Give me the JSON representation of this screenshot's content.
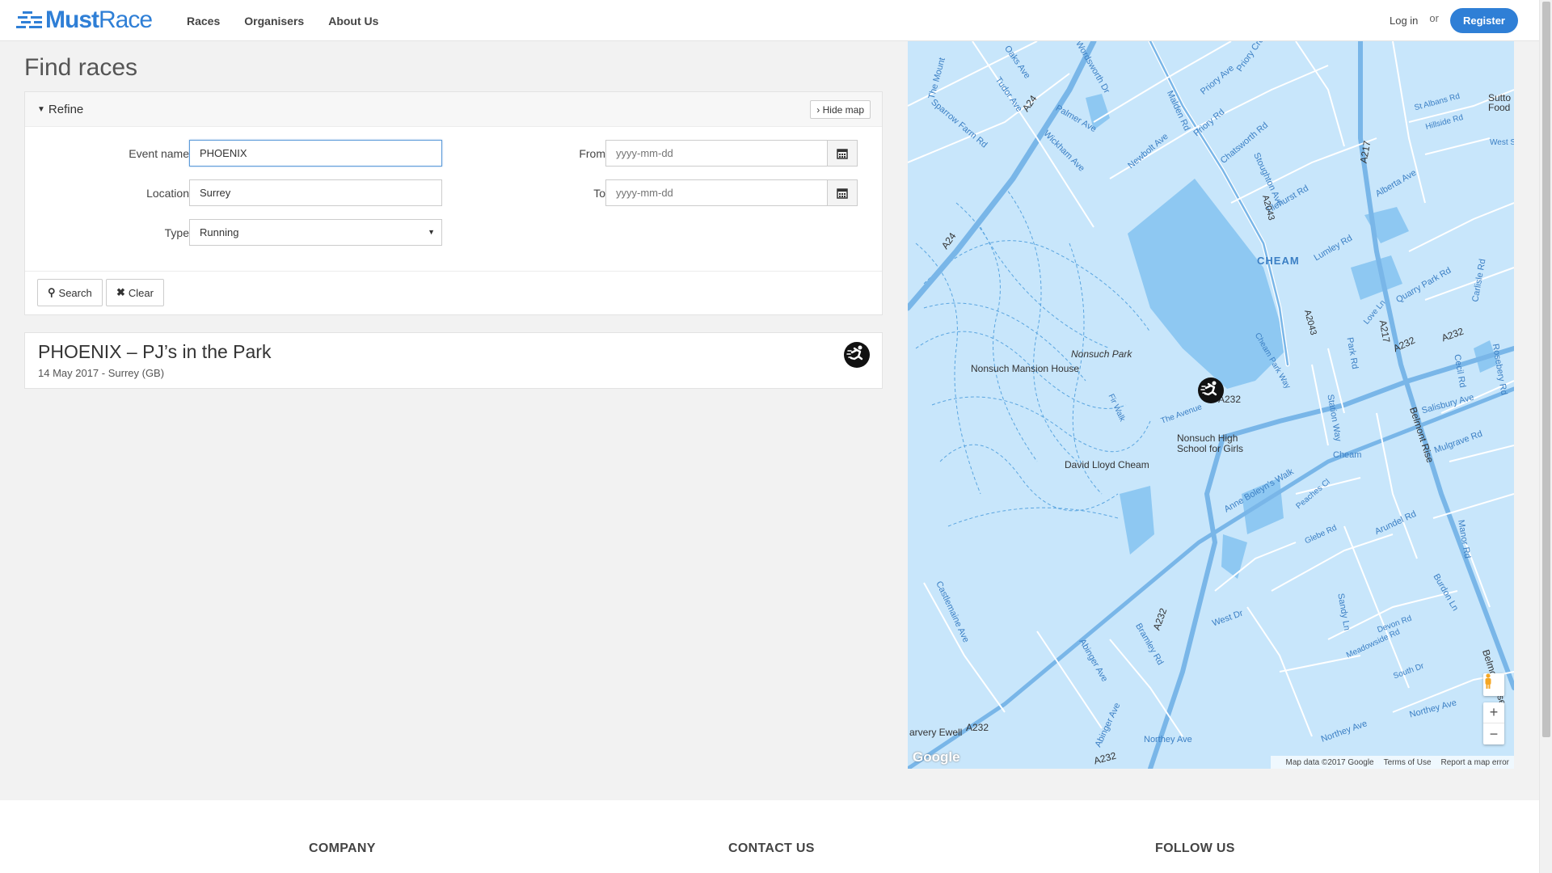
{
  "header": {
    "logo_bold": "Must",
    "logo_light": "Race",
    "nav": [
      {
        "label": "Races"
      },
      {
        "label": "Organisers"
      },
      {
        "label": "About Us"
      }
    ],
    "login_label": "Log in",
    "or_label": "or",
    "register_label": "Register",
    "accent_color": "#2f7fd6"
  },
  "main": {
    "title": "Find races",
    "refine": {
      "title": "Refine",
      "hide_map_label": "Hide map",
      "event_name_label": "Event name",
      "event_name_value": "PHOENIX",
      "location_label": "Location",
      "location_value": "Surrey",
      "type_label": "Type",
      "type_value": "Running",
      "from_label": "From",
      "from_placeholder": "yyyy-mm-dd",
      "to_label": "To",
      "to_placeholder": "yyyy-mm-dd",
      "search_label": "Search",
      "clear_label": "Clear"
    },
    "results": [
      {
        "title": "PHOENIX – PJ’s in the Park",
        "meta": "14 May 2017 - Surrey (GB)",
        "icon": "running-icon"
      }
    ]
  },
  "map": {
    "labels": {
      "cheam": "CHEAM",
      "nonsuch_park": "Nonsuch Park",
      "nonsuch_mansion": "Nonsuch Mansion House",
      "nonsuch_school": "Nonsuch High School for Girls",
      "david_lloyd": "David Lloyd Cheam",
      "cheam_station": "Cheam",
      "harvey_ewell": "arvery Ewell",
      "sutton": "Sutto Food",
      "a24": "A24",
      "a232": "A232",
      "a217": "A217",
      "belmont_rise": "Belmont Rise",
      "tudor_ave": "Tudor Ave",
      "the_mount": "The Mount",
      "sparrow_farm": "Sparrow Farm Rd",
      "palmer_ave": "Palmer Ave",
      "wickham_ave": "Wickham Ave",
      "newbolt_ave": "Newbolt Ave",
      "malden_rd": "Malden Rd",
      "priory_rd": "Priory Rd",
      "priory_ave": "Priory Ave",
      "chatsworth_rd": "Chatsworth Rd",
      "stoughton_ave": "Stoughton Ave",
      "tilehurst_rd": "Tilehurst Rd",
      "alberta_ave": "Alberta Ave",
      "lumley_rd": "Lumley Rd",
      "quarry_park_rd": "Quarry Park Rd",
      "carlisle_rd": "Carlisle Rd",
      "st_albans_rd": "St Albans Rd",
      "hillside_rd": "Hillside Rd",
      "mulgrave_rd": "Mulgrave Rd",
      "salisbury_ave": "Salisbury Ave",
      "the_avenue": "The Avenue",
      "station_way": "Station Way",
      "anne_boleyns_walk": "Anne Boleyn's Walk",
      "peaches_cl": "Peaches Cl",
      "glebe_rd": "Glebe Rd",
      "arundel_rd": "Arundel Rd",
      "west_dr": "West Dr",
      "northey_ave": "Northey Ave",
      "castlemaine_ave": "Castlemaine Ave",
      "bramley_rd": "Bramley Rd",
      "abinger_ave": "Abinger Ave",
      "sandy_ln": "Sandy Ln",
      "devon_rd": "Devon Rd",
      "meadowside_rd": "Meadowside Rd",
      "south_dr": "South Dr",
      "burdon_ln": "Burdon Ln",
      "manor_rd": "Manor Rd",
      "cheam_park_way": "Cheam Park Way",
      "fir_walk": "Fir Walk",
      "oaks_ave": "Oaks Ave",
      "wordsworth_dr": "Wordsworth Dr",
      "priory_cres": "Priory Cres",
      "ewell_rd": "West Su",
      "rosebery_rd": "Rosebery Rd",
      "cecil_rd": "Cecil Rd",
      "park_rd": "Park Rd",
      "love_ln": "Love Ln",
      "a2043": "A2043"
    },
    "google_label": "Google",
    "attribution_data": "Map data ©2017 Google",
    "attribution_terms": "Terms of Use",
    "attribution_report": "Report a map error",
    "zoom_in": "+",
    "zoom_out": "−",
    "water_color": "#c8e6fb",
    "road_color": "#79b6e8"
  },
  "footer": {
    "company": "COMPANY",
    "contact": "CONTACT US",
    "follow": "FOLLOW US"
  }
}
